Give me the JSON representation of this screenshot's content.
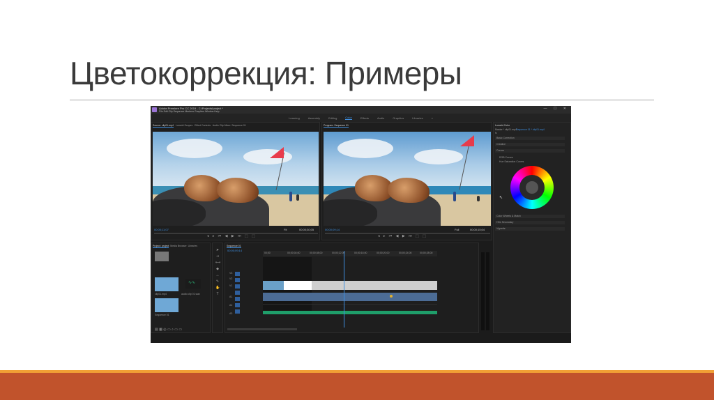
{
  "slide": {
    "title": "Цветокоррекция: Примеры"
  },
  "app": {
    "window_title": "Adobe Premiere Pro CC 2019 - C:\\Projects\\project *",
    "menu": "File  Edit  Clip  Sequence  Markers  Graphics  Window  Help",
    "window_buttons": "—  ☐  ✕",
    "workspaces": [
      {
        "label": "Learning",
        "active": false
      },
      {
        "label": "Assembly",
        "active": false
      },
      {
        "label": "Editing",
        "active": false
      },
      {
        "label": "Color",
        "active": true
      },
      {
        "label": "Effects",
        "active": false
      },
      {
        "label": "Audio",
        "active": false
      },
      {
        "label": "Graphics",
        "active": false
      },
      {
        "label": "Libraries",
        "active": false
      },
      {
        "label": "»",
        "active": false
      }
    ],
    "source_panel": {
      "tabs": [
        "Source: clip01.mp4",
        "Lumetri Scopes",
        "Effect Controls",
        "Audio Clip Mixer: Sequence 01"
      ],
      "timecode": "00;00;11;07",
      "zoom": "Fit",
      "duration": "00;00;30;05"
    },
    "program_panel": {
      "tab": "Program: Sequence 01",
      "timecode": "00;00;09;14",
      "zoom": "Full",
      "duration": "00;00;15;04"
    },
    "lumetri_panel": {
      "tab": "Lumetri Color",
      "sub_tabs": [
        "Master * clip01.mp4",
        "Sequence 01 * clip01.mp4"
      ],
      "fx": "fx",
      "sections": [
        "Basic Correction",
        "Creative",
        "Curves",
        "Color Wheels & Match",
        "HSL Secondary",
        "Vignette"
      ],
      "curve_options": [
        "RGB Curves",
        "Hue Saturation Curves"
      ]
    },
    "project_panel": {
      "tabs": [
        "Project: project",
        "Media Browser",
        "Libraries"
      ],
      "items": [
        "clip01.mp4",
        "Sequence 01"
      ],
      "audio_label": "audio clip 01.wav"
    },
    "timeline_panel": {
      "tab": "Sequence 01",
      "timecode": "00;00;09;14",
      "ruler": [
        "00;00",
        "00;00;04;00",
        "00;00;08;00",
        "00;00;12;00",
        "00;00;16;00",
        "00;00;20;00",
        "00;00;24;00",
        "00;00;28;00"
      ],
      "tracks": [
        "V3",
        "V2",
        "V1",
        "A1",
        "A2",
        "A3"
      ]
    }
  }
}
